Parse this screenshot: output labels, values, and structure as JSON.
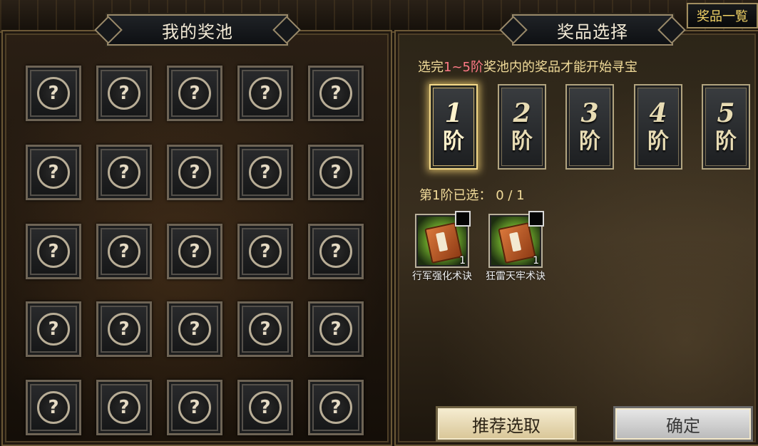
{
  "left_panel": {
    "title": "我的奖池",
    "slots": [
      "?",
      "?",
      "?",
      "?",
      "?",
      "?",
      "?",
      "?",
      "?",
      "?",
      "?",
      "?",
      "?",
      "?",
      "?",
      "?",
      "?",
      "?",
      "?",
      "?",
      "?",
      "?",
      "?",
      "?",
      "?"
    ]
  },
  "right_panel": {
    "title": "奖品选择",
    "hint": {
      "prefix": "选完",
      "accent": "1~5阶",
      "suffix": "奖池内的奖品才能开始寻宝"
    },
    "tiers": [
      {
        "num": "1",
        "char": "阶",
        "active": true
      },
      {
        "num": "2",
        "char": "阶",
        "active": false
      },
      {
        "num": "3",
        "char": "阶",
        "active": false
      },
      {
        "num": "4",
        "char": "阶",
        "active": false
      },
      {
        "num": "5",
        "char": "阶",
        "active": false
      }
    ],
    "selected_label": "第1阶已选：",
    "selected_value": "0 / 1",
    "rewards": [
      {
        "name": "行军强化术诀",
        "qty": "1",
        "icon": "book-icon",
        "checked": false
      },
      {
        "name": "狂雷天牢术诀",
        "qty": "1",
        "icon": "book-icon",
        "checked": false
      }
    ],
    "recommend_button": "推荐选取",
    "confirm_button": "确定"
  },
  "top_right_button": "奖品一覧",
  "colors": {
    "accent_text": "#ff7a86",
    "hint_text": "#f2dc9a",
    "gold": "#f1d266"
  }
}
